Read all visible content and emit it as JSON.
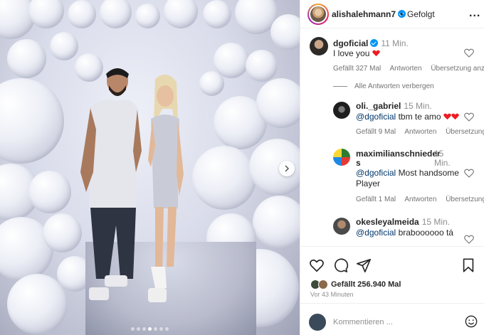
{
  "post": {
    "author": "alishalehmann7",
    "follow_separator": "•",
    "follow_status": "Gefolgt",
    "more_label": "...",
    "carousel": {
      "slides": 7,
      "active_index": 3
    }
  },
  "comments": [
    {
      "user": "dgoficial",
      "verified": true,
      "time": "11 Min.",
      "text": "I love you",
      "likes": "Gefällt 327 Mal",
      "reply": "Antworten",
      "translate": "Übersetzung anze"
    },
    {
      "user": "oli._gabriel",
      "time": "15 Min.",
      "mention": "@dgoficial",
      "text": "tbm te amo",
      "likes": "Gefällt 9 Mal",
      "reply": "Antworten",
      "translate": "Übersetzung"
    },
    {
      "user_line1": "maximilianschnieder",
      "user_line2": "s",
      "time_line1": "15",
      "time_line2": "Min.",
      "mention": "@dgoficial",
      "text_line1": "Most handsome",
      "text_line2": "Player",
      "likes": "Gefällt 1 Mal",
      "reply": "Antworten",
      "translate": "Übersetzung"
    },
    {
      "user": "okesleyalmeida",
      "time": "15 Min.",
      "mention": "@dgoficial",
      "text": "braboooooo tá"
    }
  ],
  "hide_replies": "Alle Antworten verbergen",
  "actions": {
    "likes_text": "Gefällt 256.940 Mal",
    "time_ago": "Vor 43 Minuten"
  },
  "composer": {
    "placeholder": "Kommentieren ..."
  },
  "colors": {
    "link": "#00376b",
    "verified": "#0095f6",
    "heart_red": "#ed1c24",
    "muted": "#737373"
  }
}
